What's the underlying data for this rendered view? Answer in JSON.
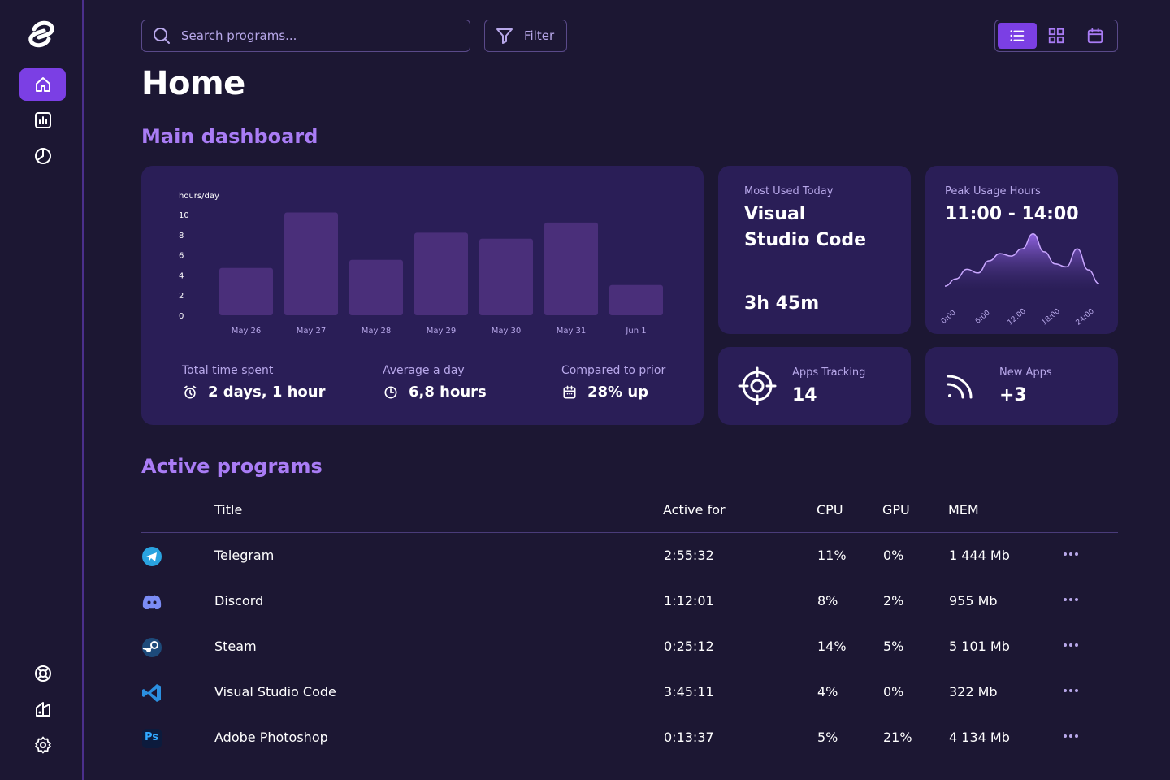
{
  "search": {
    "placeholder": "Search programs..."
  },
  "filter": {
    "label": "Filter"
  },
  "page": {
    "title": "Home"
  },
  "sections": {
    "dashboard": "Main dashboard",
    "active": "Active programs"
  },
  "colors": {
    "accent": "#7b3fe4",
    "bg": "#1c1733",
    "card": "#2a1e57",
    "bar": "#4a2f7a",
    "label": "#b8a8ea"
  },
  "chart_data": {
    "type": "bar",
    "ylabel": "hours/day",
    "ylim": [
      0,
      10
    ],
    "yticks": [
      "0",
      "2",
      "4",
      "6",
      "8",
      "10"
    ],
    "categories": [
      "May 26",
      "May 27",
      "May 28",
      "May 29",
      "May 30",
      "May 31",
      "Jun 1"
    ],
    "values": [
      4.7,
      10.2,
      5.5,
      8.2,
      7.6,
      9.2,
      3.0
    ]
  },
  "stats": {
    "total": {
      "label": "Total time spent",
      "value": "2 days, 1 hour",
      "icon": "alarm-clock-icon"
    },
    "average": {
      "label": "Average a day",
      "value": "6,8 hours",
      "icon": "clock-icon"
    },
    "compare": {
      "label": "Compared to prior",
      "value": "28% up",
      "icon": "calendar-icon"
    }
  },
  "most_used": {
    "label": "Most Used Today",
    "app_line1": "Visual",
    "app_line2": "Studio Code",
    "time": "3h 45m"
  },
  "peak": {
    "label": "Peak Usage Hours",
    "range": "11:00 - 14:00",
    "ticks": [
      "0:00",
      "6:00",
      "12:00",
      "18:00",
      "24:00"
    ],
    "curve": [
      0.08,
      0.2,
      0.36,
      0.3,
      0.5,
      0.62,
      0.58,
      0.7,
      0.95,
      0.65,
      0.45,
      0.4,
      0.7,
      0.35,
      0.12
    ]
  },
  "tracking": {
    "label": "Apps Tracking",
    "value": "14"
  },
  "new_apps": {
    "label": "New Apps",
    "value": "+3"
  },
  "table": {
    "headers": {
      "title": "Title",
      "active": "Active for",
      "cpu": "CPU",
      "gpu": "GPU",
      "mem": "MEM"
    },
    "rows": [
      {
        "icon": "telegram-icon",
        "title": "Telegram",
        "active": "2:55:32",
        "cpu": "11%",
        "gpu": "0%",
        "mem": "1 444 Mb"
      },
      {
        "icon": "discord-icon",
        "title": "Discord",
        "active": "1:12:01",
        "cpu": "8%",
        "gpu": "2%",
        "mem": "955 Mb"
      },
      {
        "icon": "steam-icon",
        "title": "Steam",
        "active": "0:25:12",
        "cpu": "14%",
        "gpu": "5%",
        "mem": "5 101 Mb"
      },
      {
        "icon": "vscode-icon",
        "title": "Visual Studio Code",
        "active": "3:45:11",
        "cpu": "4%",
        "gpu": "0%",
        "mem": "322 Mb"
      },
      {
        "icon": "photoshop-icon",
        "title": "Adobe Photoshop",
        "active": "0:13:37",
        "cpu": "5%",
        "gpu": "21%",
        "mem": "4 134 Mb"
      }
    ],
    "photoshop_badge": "Ps"
  }
}
